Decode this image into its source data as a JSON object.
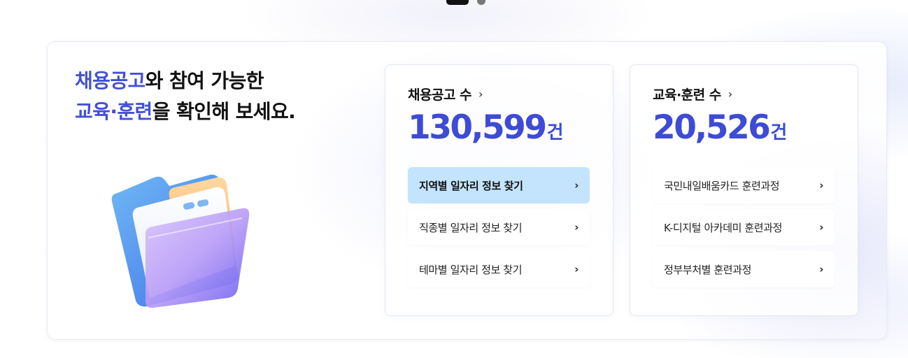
{
  "pager": {
    "total_pages": 2,
    "active_page": 1
  },
  "headline": {
    "line1_accent": "채용공고",
    "line1_rest": "와 참여 가능한",
    "line2_accent": "교육·훈련",
    "line2_rest": "을 확인해 보세요."
  },
  "illustration": {
    "icon": "folder-icon"
  },
  "jobs": {
    "title": "채용공고 수",
    "chevron": "›",
    "count": "130,599",
    "unit": "건",
    "links": [
      {
        "label": "지역별 일자리 정보 찾기",
        "selected": true
      },
      {
        "label": "직종별 일자리 정보 찾기",
        "selected": false
      },
      {
        "label": "테마별 일자리 정보 찾기",
        "selected": false
      }
    ]
  },
  "training": {
    "title": "교육·훈련 수",
    "chevron": "›",
    "count": "20,526",
    "unit": "건",
    "links": [
      {
        "label": "국민내일배움카드 훈련과정",
        "selected": false
      },
      {
        "label": "K-디지털 아카데미 훈련과정",
        "selected": false
      },
      {
        "label": "정부부처별 훈련과정",
        "selected": false
      }
    ]
  },
  "colors": {
    "accent": "#3d4bd6",
    "selected_bg": "#c3e4fc"
  }
}
